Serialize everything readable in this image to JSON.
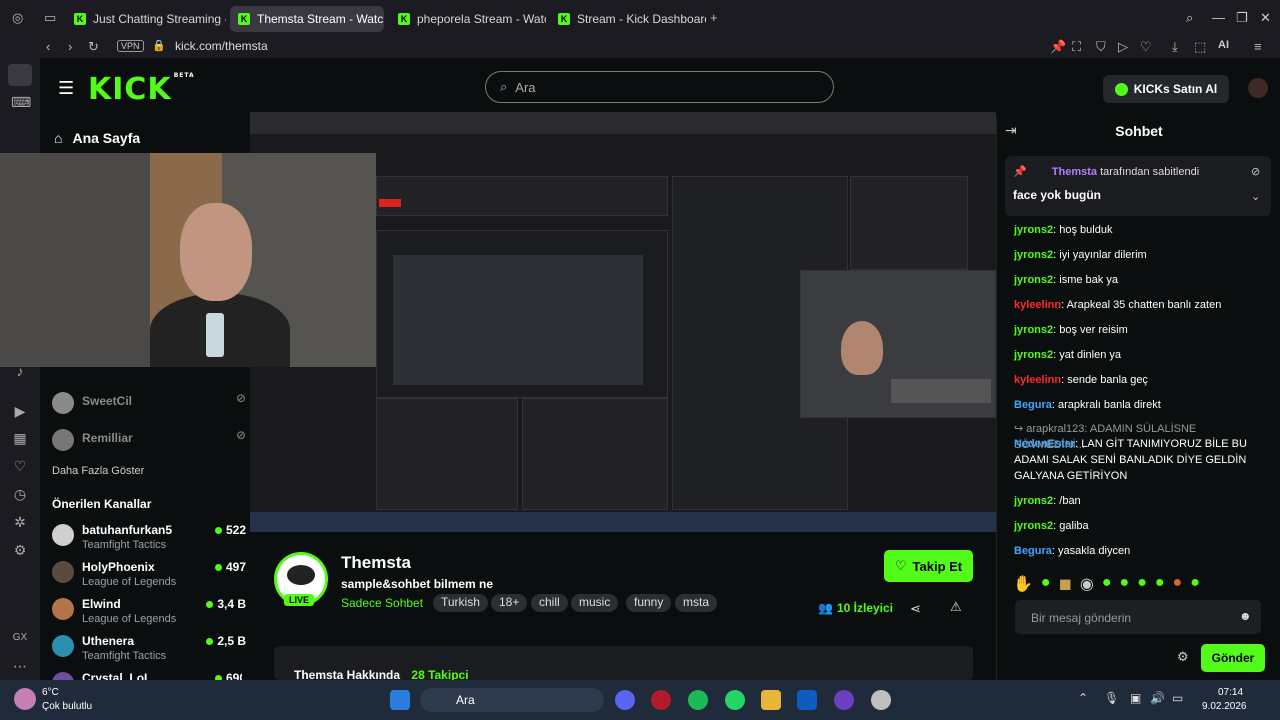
{
  "browser": {
    "tabs": [
      {
        "label": "Just Chatting Streaming - K"
      },
      {
        "label": "Themsta Stream - Watch L"
      },
      {
        "label": "pheporela Stream - Watch"
      },
      {
        "label": "Stream - Kick Dashboard"
      }
    ],
    "url": "kick.com/themsta",
    "vpn_label": "VPN",
    "ai_label": "AI"
  },
  "header": {
    "logo": "KICK",
    "logo_beta": "BETA",
    "search_placeholder": "Ara",
    "kicks_button": "KICKs Satın Al"
  },
  "sidebar": {
    "home_label": "Ana Sayfa",
    "followed": [
      {
        "name": "SweetCil"
      },
      {
        "name": "Remilliar"
      }
    ],
    "show_more": "Daha Fazla Göster",
    "recommended_title": "Önerilen Kanallar",
    "recommended": [
      {
        "name": "batuhanfurkan5",
        "game": "Teamfight Tactics",
        "viewers": "522"
      },
      {
        "name": "HolyPhoenix",
        "game": "League of Legends",
        "viewers": "497"
      },
      {
        "name": "Elwind",
        "game": "League of Legends",
        "viewers": "3,4 B"
      },
      {
        "name": "Uthenera",
        "game": "Teamfight Tactics",
        "viewers": "2,5 B"
      },
      {
        "name": "Crystal_LoL",
        "game": "",
        "viewers": "690"
      }
    ]
  },
  "channel": {
    "name": "Themsta",
    "live": "LIVE",
    "title": "sample&sohbet bilmem ne",
    "category": "Sadece Sohbet",
    "tags": [
      "Turkish",
      "18+",
      "chill",
      "music",
      "funny",
      "msta"
    ],
    "follow_button": "Takip Et",
    "viewers_count": "10",
    "viewers_label": "İzleyici",
    "about_label": "Themsta Hakkında",
    "followers": "28 Takipci"
  },
  "chat": {
    "title": "Sohbet",
    "pinned_by": "Themsta",
    "pinned_suffix": "tarafından sabitlendi",
    "pinned_text": "face yok bugün",
    "messages": [
      {
        "user": "jyrons2",
        "text": "hoş bulduk",
        "color": "#53fc18"
      },
      {
        "user": "jyrons2",
        "text": "iyi yayınlar dilerim",
        "color": "#53fc18"
      },
      {
        "user": "jyrons2",
        "text": "isme bak ya",
        "color": "#53fc18"
      },
      {
        "user": "kyleelinn",
        "text": "Arapkeal 35 chatten banlı zaten",
        "color": "#ff2a2a"
      },
      {
        "user": "jyrons2",
        "text": "boş ver reisim",
        "color": "#53fc18"
      },
      {
        "user": "jyrons2",
        "text": "yat dinlen ya",
        "color": "#53fc18"
      },
      {
        "user": "kyleelinn",
        "text": "sende banla geç",
        "color": "#ff2a2a"
      },
      {
        "user": "Begura",
        "text": "arapkralı banla direkt",
        "color": "#3fa7ff"
      }
    ],
    "reply_ref": "arapkral123: ADAMIN SÜLALİSNE SÖVMEDİNİ...",
    "reply_user": "NedenEster",
    "reply_text": "LAN GİT TANIMIYORUZ BİLE BU ADAMI SALAK SENİ BANLADIK DİYE GELDİN GALYANA GETİRİYON",
    "messages2": [
      {
        "user": "jyrons2",
        "text": "/ban",
        "color": "#53fc18"
      },
      {
        "user": "jyrons2",
        "text": "galiba",
        "color": "#53fc18"
      },
      {
        "user": "Begura",
        "text": "yasakla diycen",
        "color": "#3fa7ff"
      }
    ],
    "input_placeholder": "Bir mesaj gönderin",
    "send_button": "Gönder"
  },
  "taskbar": {
    "weather_temp": "6°C",
    "weather_desc": "Çok bulutlu",
    "search_label": "Ara",
    "time": "07:14",
    "date": "9.02.2026"
  },
  "colors": {
    "accent": "#53fc18",
    "bg": "#0b0e0f"
  }
}
